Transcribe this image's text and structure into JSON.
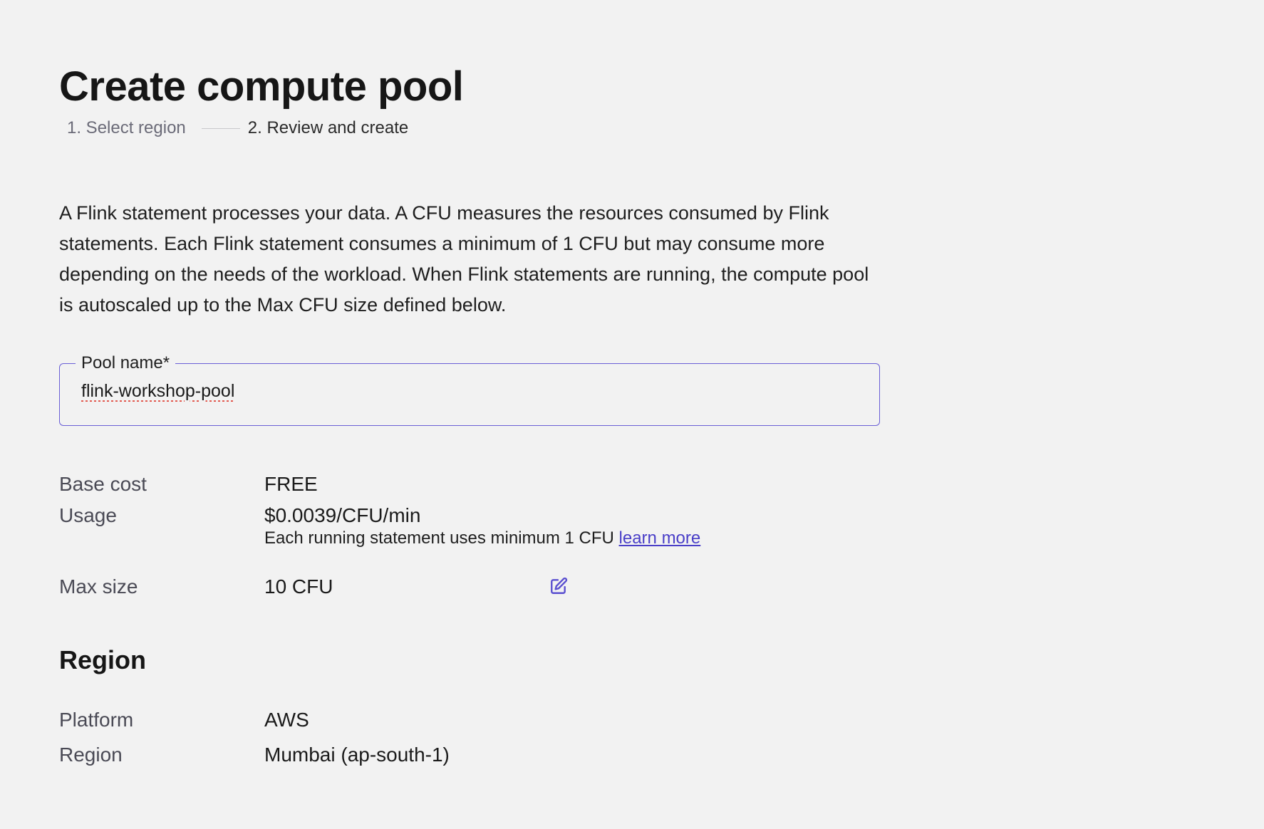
{
  "page": {
    "title": "Create compute pool"
  },
  "stepper": {
    "steps": [
      {
        "label": "1. Select region",
        "state": "complete"
      },
      {
        "label": "2. Review and create",
        "state": "active"
      }
    ]
  },
  "description": "A Flink statement processes your data. A CFU measures the resources consumed by Flink statements. Each Flink statement consumes a minimum of 1 CFU but may consume more depending on the needs of the workload. When Flink statements are running, the compute pool is autoscaled up to the Max CFU size defined below.",
  "pool_name_field": {
    "label": "Pool name*",
    "value": "flink-workshop-pool"
  },
  "pricing": {
    "base_cost": {
      "label": "Base cost",
      "value": "FREE"
    },
    "usage": {
      "label": "Usage",
      "value": "$0.0039/CFU/min",
      "note": "Each running statement uses minimum 1 CFU ",
      "link_text": "learn more"
    },
    "max_size": {
      "label": "Max size",
      "value": "10 CFU",
      "edit_icon": "edit-icon"
    }
  },
  "region_section": {
    "title": "Region",
    "platform": {
      "label": "Platform",
      "value": "AWS"
    },
    "region": {
      "label": "Region",
      "value": "Mumbai (ap-south-1)"
    }
  },
  "colors": {
    "background": "#f2f2f2",
    "accent": "#6a5fd6",
    "link": "#4a3fc8",
    "muted_text": "#4a4a55"
  }
}
